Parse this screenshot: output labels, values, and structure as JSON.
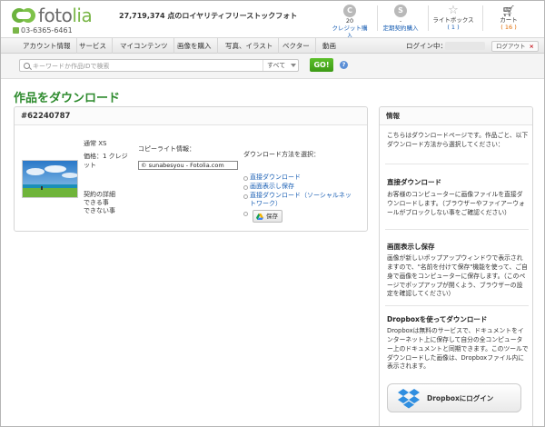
{
  "header": {
    "logo_text_a": "foto",
    "logo_text_b": "lia",
    "phone": "03-6365-6461",
    "tagline": "27,719,374 点のロイヤリティフリーストックフォト",
    "credits": {
      "circle": "C",
      "count": "20",
      "label": "クレジット購入"
    },
    "subscription": {
      "circle": "S",
      "count": "-",
      "label": "定期契約購入"
    },
    "lightbox": {
      "label": "ライトボックス",
      "count": "( 1 )"
    },
    "cart": {
      "label": "カート",
      "count": "( 16 )"
    }
  },
  "nav": {
    "items": [
      "アカウント情報",
      "サービス",
      "マイコンテンツ",
      "画像を購入",
      "写真、イラスト",
      "ベクター",
      "動画"
    ],
    "login_label": "ログイン中：",
    "logout_label": "ログアウト",
    "logout_x": "×"
  },
  "search": {
    "placeholder": "キーワードか作品IDで検索",
    "select_value": "すべて",
    "go_label": "GO!",
    "help": "?"
  },
  "page": {
    "title": "作品をダウンロード"
  },
  "item": {
    "id": "#62240787",
    "size_label": "通常 XS",
    "price_line1": "価格：1 クレジ",
    "price_line2": "ット",
    "contract_line1": "契約の詳細",
    "contract_line2": "できる事",
    "contract_line3": "できない事",
    "copyright_label": "コピーライト情報：",
    "copyright_value": "© sunabesyou - Fotolia.com",
    "method_label": "ダウンロード方法を選択：",
    "options": [
      "直接ダウンロード",
      "画面表示し保存",
      "直接ダウンロード（ソーシャルネッ",
      "トワーク）"
    ],
    "save_label": "保存"
  },
  "sidebar": {
    "heading": "情報",
    "intro": "こちらはダウンロードページです。作品ごと、以下ダウンロード方法から選択してください：",
    "s1_title": "直接ダウンロード",
    "s1_text": "お客様のコンピューターに画像ファイルを直接ダウンロードします。（ブラウザーやファイアーウォールがブロックしない事をご確認ください）",
    "s2_title": "画面表示し保存",
    "s2_text": "画像が新しいポップアップウィンドウで表示されますので、\"名前を付けて保存\"機能を使って、ご自身で画像をコンピューターに保存します。（このページでポップアップが開くよう、ブラウザーの設定を確認してください）",
    "s3_title": "Dropboxを使ってダウンロード",
    "s3_text": "Dropboxは無料のサービスで、ドキュメントをインターネット上に保存して自分の全コンピューター上のドキュメントと同期できます。このツールでダウンロードした画像は、Dropboxファイル内に表示されます。",
    "dropbox_label": "Dropboxにログイン"
  },
  "colors": {
    "brand_green": "#7ab648",
    "title_green": "#2e8b2e",
    "link_blue": "#1a5fb4",
    "cart_orange": "#e06a00"
  }
}
